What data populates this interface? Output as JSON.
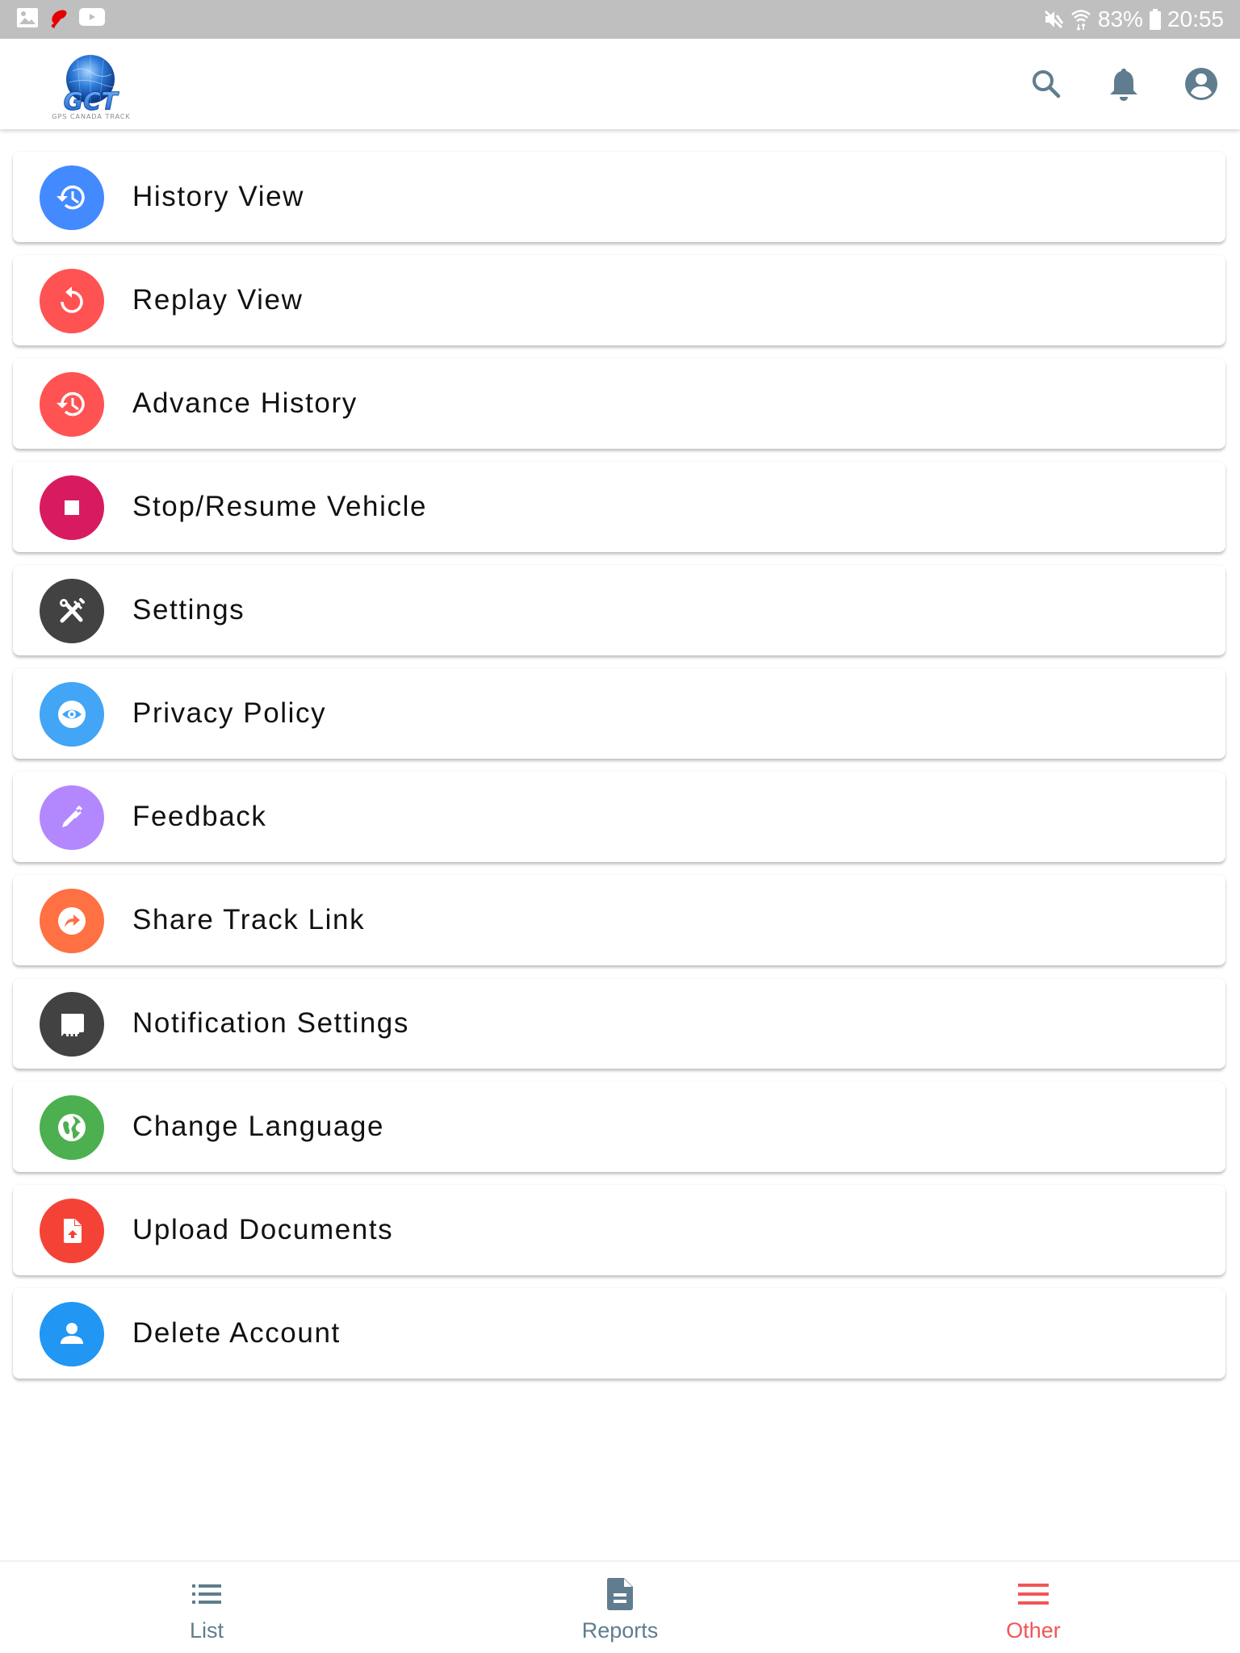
{
  "status_bar": {
    "left_icons": [
      "gallery-notification-icon",
      "airtel-notification-icon",
      "youtube-notification-icon"
    ],
    "right_icons": [
      "mute-icon",
      "wifi-icon",
      "battery-icon"
    ],
    "battery": "83%",
    "time": "20:55"
  },
  "header": {
    "logo_text": "GCT",
    "logo_tagline": "GPS CANADA TRACK",
    "actions": [
      {
        "name": "search",
        "icon": "search-icon"
      },
      {
        "name": "notifications",
        "icon": "bell-icon"
      },
      {
        "name": "profile",
        "icon": "account-circle-icon"
      }
    ],
    "icon_color": "#5f7d8e"
  },
  "menu": {
    "items": [
      {
        "label": "History View",
        "icon": "history-icon",
        "color": "#448aff"
      },
      {
        "label": "Replay View",
        "icon": "replay-icon",
        "color": "#ff5252"
      },
      {
        "label": "Advance History",
        "icon": "history-icon",
        "color": "#ff5252"
      },
      {
        "label": "Stop/Resume Vehicle",
        "icon": "stop-icon",
        "color": "#d81b60"
      },
      {
        "label": "Settings",
        "icon": "tools-icon",
        "color": "#424242"
      },
      {
        "label": "Privacy Policy",
        "icon": "eye-icon",
        "color": "#42a5f5"
      },
      {
        "label": "Feedback",
        "icon": "pen-icon",
        "color": "#b388ff"
      },
      {
        "label": "Share Track Link",
        "icon": "share-icon",
        "color": "#ff7043"
      },
      {
        "label": "Notification Settings",
        "icon": "chat-bubble-icon",
        "color": "#424242"
      },
      {
        "label": "Change Language",
        "icon": "globe-icon",
        "color": "#4caf50"
      },
      {
        "label": "Upload Documents",
        "icon": "file-upload-icon",
        "color": "#f44336"
      },
      {
        "label": "Delete Account",
        "icon": "person-icon",
        "color": "#2196f3"
      }
    ]
  },
  "bottom_nav": {
    "items": [
      {
        "label": "List",
        "icon": "list-icon",
        "active": false
      },
      {
        "label": "Reports",
        "icon": "document-icon",
        "active": false
      },
      {
        "label": "Other",
        "icon": "menu-icon",
        "active": true
      }
    ],
    "inactive_color": "#5f7d8e",
    "active_color": "#f25656"
  }
}
